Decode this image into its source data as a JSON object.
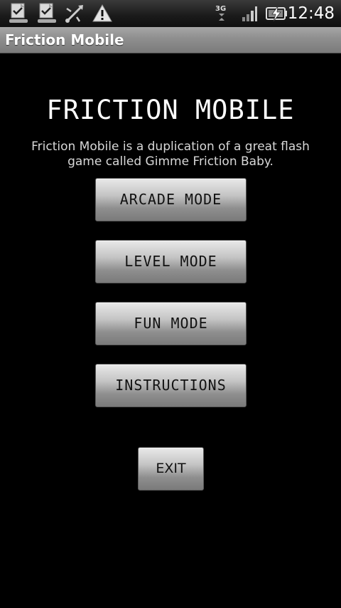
{
  "status_bar": {
    "icons": [
      "download-complete-icon",
      "download-complete-icon",
      "usb-debug-icon",
      "warning-icon",
      "network-3g-icon",
      "signal-icon",
      "battery-charging-icon"
    ],
    "network_label": "3G",
    "time": "12:48"
  },
  "app": {
    "title": "Friction Mobile"
  },
  "main": {
    "heading": "FRICTION MOBILE",
    "description": "Friction Mobile is a duplication of a great flash game called Gimme Friction Baby.",
    "buttons": {
      "arcade": "ARCADE MODE",
      "level": "LEVEL MODE",
      "fun": "FUN MODE",
      "instructions": "INSTRUCTIONS",
      "exit": "EXIT"
    }
  }
}
